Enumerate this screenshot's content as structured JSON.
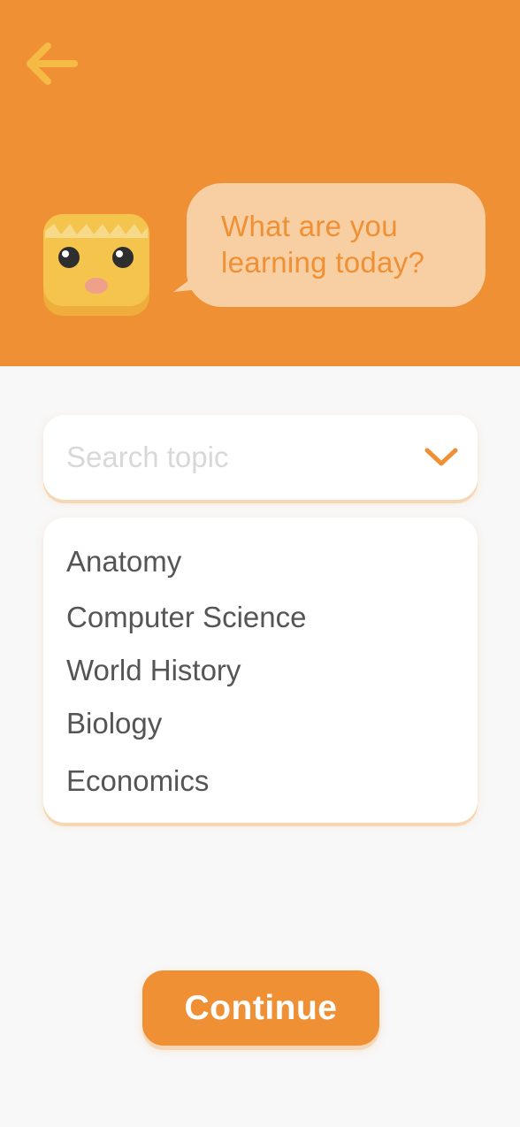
{
  "header": {
    "background_color": "#ef9035",
    "back_icon": "arrow-left-icon",
    "mascot_icon": "mascot-icon",
    "bubble": {
      "line1": "What are you",
      "line2": "learning today?",
      "color": "#f8cfa2",
      "text_color": "#ef9035"
    }
  },
  "search": {
    "placeholder": "Search topic",
    "value": "",
    "dropdown_icon": "chevron-down-icon"
  },
  "topics": [
    "Anatomy",
    "Computer Science",
    "World History",
    "Biology",
    "Economics"
  ],
  "footer": {
    "continue_label": "Continue",
    "accent_color": "#ef9035"
  }
}
